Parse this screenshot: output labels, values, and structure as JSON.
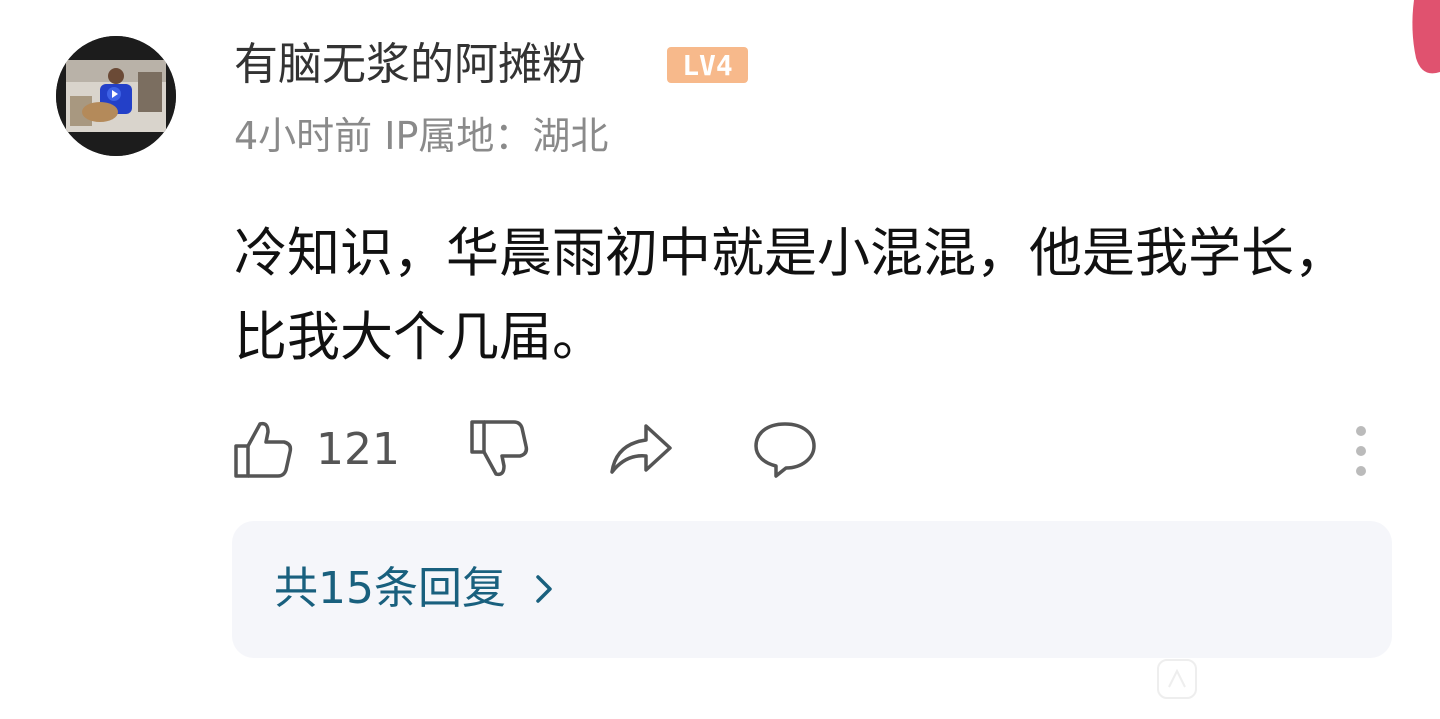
{
  "comment": {
    "username": "有脑无浆的阿摊粉",
    "level_badge": "LV4",
    "meta": "4小时前 IP属地：湖北",
    "text": "冷知识，华晨雨初中就是小混混，他是我学长，比我大个几届。",
    "like_count": "121",
    "reply_summary": "共15条回复"
  },
  "icons": {
    "like": "thumbs-up-icon",
    "dislike": "thumbs-down-icon",
    "share": "share-icon",
    "reply": "comment-bubble-icon",
    "more": "more-vertical-icon",
    "chevron": "chevron-right-icon"
  },
  "colors": {
    "level_badge": "#f7b98b",
    "reply_link": "#19607e",
    "reply_box_bg": "#f5f6fa",
    "corner_accent": "#e0526f"
  }
}
